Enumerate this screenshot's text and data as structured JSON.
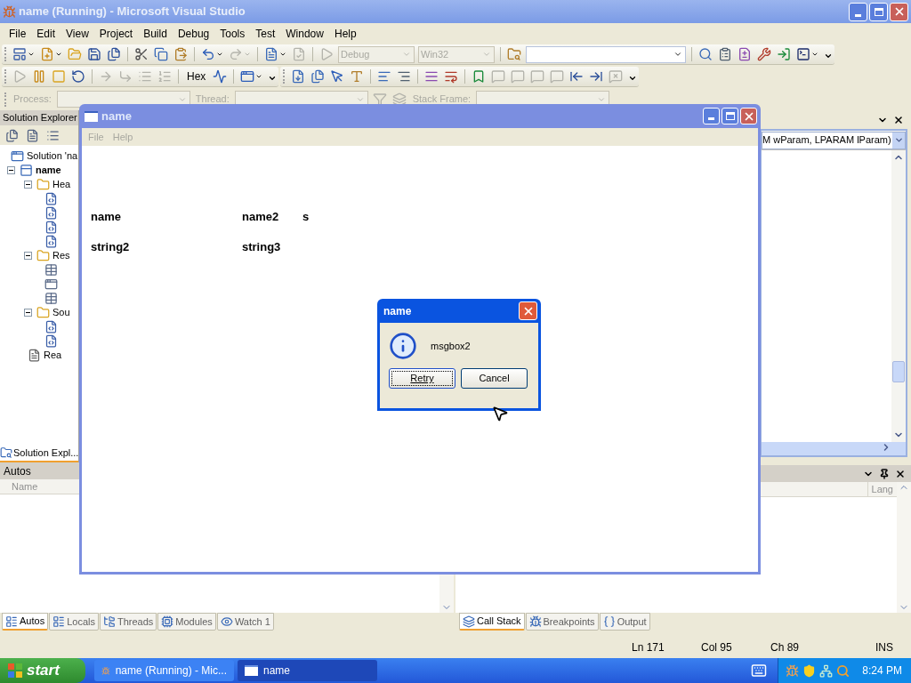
{
  "ide": {
    "title": "name (Running) - Microsoft Visual Studio",
    "menu": [
      "File",
      "Edit",
      "View",
      "Project",
      "Build",
      "Debug",
      "Tools",
      "Test",
      "Window",
      "Help"
    ],
    "toolbars": [
      [
        [
          {
            "kind": "button",
            "disabled": false,
            "menu": true
          },
          {
            "kind": "button",
            "disabled": false,
            "menu": true
          },
          {
            "kind": "button",
            "disabled": false
          },
          {
            "kind": "button",
            "disabled": false
          },
          {
            "kind": "button",
            "disabled": false
          },
          {
            "kind": "separator"
          },
          {
            "kind": "button",
            "disabled": false
          },
          {
            "kind": "button",
            "disabled": false
          },
          {
            "kind": "button",
            "disabled": false
          },
          {
            "kind": "separator"
          },
          {
            "kind": "button",
            "disabled": false,
            "menu": true
          },
          {
            "kind": "button",
            "disabled": true,
            "menu": true
          },
          {
            "kind": "separator"
          },
          {
            "kind": "button",
            "disabled": false,
            "menu": true
          },
          {
            "kind": "button",
            "disabled": true
          },
          {
            "kind": "separator"
          },
          {
            "kind": "button",
            "disabled": true
          },
          {
            "kind": "combo",
            "value": "Debug",
            "disabled": true
          },
          {
            "kind": "combo",
            "value": "Win32",
            "disabled": true
          },
          {
            "kind": "separator"
          },
          {
            "kind": "button",
            "disabled": false
          },
          {
            "kind": "search-combo",
            "disabled": false
          },
          {
            "kind": "separator"
          },
          {
            "kind": "button",
            "disabled": false
          },
          {
            "kind": "button",
            "disabled": false
          },
          {
            "kind": "button",
            "disabled": false
          },
          {
            "kind": "button",
            "disabled": false
          },
          {
            "kind": "button",
            "disabled": false
          },
          {
            "kind": "button",
            "disabled": false,
            "menu": true
          },
          {
            "kind": "overflow"
          }
        ]
      ],
      [
        [
          {
            "kind": "button",
            "disabled": true
          },
          {
            "kind": "button",
            "disabled": false
          },
          {
            "kind": "button",
            "disabled": false
          },
          {
            "kind": "button",
            "disabled": false
          },
          {
            "kind": "separator"
          },
          {
            "kind": "button",
            "disabled": true
          },
          {
            "kind": "button",
            "disabled": true
          },
          {
            "kind": "button",
            "disabled": true
          },
          {
            "kind": "button",
            "disabled": true
          },
          {
            "kind": "separator"
          },
          {
            "kind": "text",
            "label": "Hex"
          },
          {
            "kind": "button",
            "disabled": false
          },
          {
            "kind": "separator"
          },
          {
            "kind": "button",
            "disabled": false,
            "menu": true
          },
          {
            "kind": "overflow"
          }
        ],
        [
          {
            "kind": "button",
            "disabled": false
          },
          {
            "kind": "button",
            "disabled": false
          },
          {
            "kind": "button",
            "disabled": false
          },
          {
            "kind": "button",
            "disabled": false
          },
          {
            "kind": "separator"
          },
          {
            "kind": "button",
            "disabled": false
          },
          {
            "kind": "button",
            "disabled": false
          },
          {
            "kind": "separator"
          },
          {
            "kind": "button",
            "disabled": false
          },
          {
            "kind": "button",
            "disabled": false
          },
          {
            "kind": "separator"
          },
          {
            "kind": "button",
            "disabled": false
          },
          {
            "kind": "button",
            "disabled": true
          },
          {
            "kind": "button",
            "disabled": true
          },
          {
            "kind": "button",
            "disabled": true
          },
          {
            "kind": "button",
            "disabled": true
          },
          {
            "kind": "button",
            "disabled": false
          },
          {
            "kind": "button",
            "disabled": false
          },
          {
            "kind": "button",
            "disabled": true
          },
          {
            "kind": "overflow"
          }
        ]
      ],
      [
        [
          {
            "kind": "label",
            "label": "Process:",
            "disabled": true
          },
          {
            "kind": "combo",
            "disabled": true
          },
          {
            "kind": "label",
            "label": "Thread:",
            "disabled": true
          },
          {
            "kind": "combo",
            "disabled": true
          },
          {
            "kind": "button",
            "disabled": true
          },
          {
            "kind": "button",
            "disabled": true
          },
          {
            "kind": "label",
            "label": "Stack Frame:",
            "disabled": true
          },
          {
            "kind": "combo",
            "disabled": true
          }
        ]
      ]
    ],
    "solution_explorer": {
      "title": "Solution Explorer",
      "tab": "Solution Expl...",
      "tree": [
        {
          "kind": "solution",
          "label": "Solution 'na",
          "children": [
            {
              "kind": "project",
              "label": "name",
              "expanded": true,
              "children": [
                {
                  "kind": "folder",
                  "label": "Hea",
                  "expanded": true,
                  "children": [
                    {
                      "kind": "header"
                    },
                    {
                      "kind": "header"
                    },
                    {
                      "kind": "header"
                    },
                    {
                      "kind": "header"
                    }
                  ]
                },
                {
                  "kind": "folder",
                  "label": "Res",
                  "expanded": true,
                  "children": [
                    {
                      "kind": "resource"
                    },
                    {
                      "kind": "dialog"
                    },
                    {
                      "kind": "resource"
                    }
                  ]
                },
                {
                  "kind": "folder",
                  "label": "Sou",
                  "expanded": true,
                  "children": [
                    {
                      "kind": "cpp"
                    },
                    {
                      "kind": "cpp"
                    }
                  ]
                },
                {
                  "kind": "text",
                  "label": "Rea"
                }
              ]
            }
          ]
        }
      ]
    },
    "editor": {
      "member_combo": "M wParam, LPARAM lParam)"
    },
    "autos": {
      "title": "Autos",
      "columns": [
        "Name"
      ],
      "tabs": [
        {
          "label": "Autos",
          "selected": true
        },
        {
          "label": "Locals",
          "selected": false
        },
        {
          "label": "Threads",
          "selected": false
        },
        {
          "label": "Modules",
          "selected": false
        },
        {
          "label": "Watch 1",
          "selected": false
        }
      ]
    },
    "call_stack": {
      "columns": [
        "Lang"
      ],
      "tabs": [
        {
          "label": "Call Stack",
          "selected": true
        },
        {
          "label": "Breakpoints",
          "selected": false
        },
        {
          "label": "Output",
          "selected": false
        }
      ]
    },
    "status_bar": [
      "Ln 171",
      "Col 95",
      "Ch 89",
      "INS"
    ]
  },
  "app_window": {
    "title": "name",
    "menu": [
      {
        "label": "File",
        "disabled": true
      },
      {
        "label": "Help",
        "disabled": true
      }
    ],
    "rows": [
      [
        "name",
        "name2",
        "s"
      ],
      [
        "string2",
        "string3"
      ]
    ]
  },
  "message_box": {
    "title": "name",
    "message": "msgbox2",
    "buttons": [
      {
        "label": "Retry",
        "focused": true
      },
      {
        "label": "Cancel",
        "focused": false
      }
    ]
  },
  "taskbar": {
    "start": "start",
    "items": [
      {
        "label": "name (Running) - Mic...",
        "selected": false,
        "kind": "ide"
      },
      {
        "label": "name",
        "selected": true,
        "kind": "window"
      }
    ],
    "clock": "8:24 PM"
  }
}
